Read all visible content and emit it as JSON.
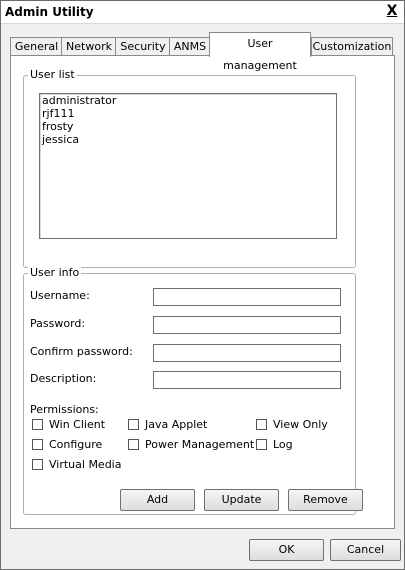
{
  "window": {
    "title": "Admin Utility",
    "close_label": "X"
  },
  "tabs": [
    {
      "label": "General"
    },
    {
      "label": "Network"
    },
    {
      "label": "Security"
    },
    {
      "label": "ANMS"
    },
    {
      "label": "User management",
      "active": true
    },
    {
      "label": "Customization"
    }
  ],
  "user_list": {
    "legend": "User list",
    "items": [
      "administrator",
      "rjf111",
      "frosty",
      "jessica"
    ]
  },
  "user_info": {
    "legend": "User info",
    "username_label": "Username:",
    "password_label": "Password:",
    "confirm_label": "Confirm password:",
    "description_label": "Description:",
    "username_value": "",
    "password_value": "",
    "confirm_value": "",
    "description_value": ""
  },
  "permissions": {
    "label": "Permissions:",
    "win_client": "Win Client",
    "java_applet": "Java Applet",
    "view_only": "View Only",
    "configure": "Configure",
    "power_management": "Power Management",
    "log": "Log",
    "virtual_media": "Virtual Media"
  },
  "actions": {
    "add": "Add",
    "update": "Update",
    "remove": "Remove"
  },
  "dialog": {
    "ok": "OK",
    "cancel": "Cancel"
  }
}
